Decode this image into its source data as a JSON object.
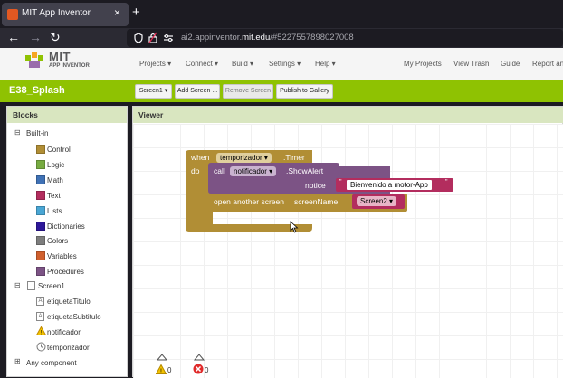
{
  "browser": {
    "tab_title": "MIT App Inventor",
    "tab_close": "×",
    "new_tab": "+",
    "url_prefix": "ai2.appinventor.",
    "url_host": "mit.edu",
    "url_rest": "/#5227557898027008"
  },
  "header": {
    "logo_title": "MIT",
    "logo_subtitle": "APP INVENTOR",
    "menus": [
      "Projects ▾",
      "Connect ▾",
      "Build ▾",
      "Settings ▾",
      "Help ▾"
    ],
    "right_links": [
      "My Projects",
      "View Trash",
      "Guide",
      "Report an"
    ]
  },
  "toolbar": {
    "project_name": "E38_Splash",
    "screen_select": "Screen1 ▾",
    "add_screen": "Add Screen ...",
    "remove_screen": "Remove Screen",
    "publish": "Publish to Gallery"
  },
  "blocks_panel": {
    "title": "Blocks",
    "builtin_label": "Built-in",
    "builtin": [
      {
        "label": "Control",
        "color": "#b18e35"
      },
      {
        "label": "Logic",
        "color": "#77ab41"
      },
      {
        "label": "Math",
        "color": "#3f71b5"
      },
      {
        "label": "Text",
        "color": "#b32d5e"
      },
      {
        "label": "Lists",
        "color": "#49a6d4"
      },
      {
        "label": "Dictionaries",
        "color": "#2d1799"
      },
      {
        "label": "Colors",
        "color": "#7d7d7d"
      },
      {
        "label": "Variables",
        "color": "#d05f2d"
      },
      {
        "label": "Procedures",
        "color": "#7c5385"
      }
    ],
    "screen_label": "Screen1",
    "components": [
      "etiquetaTitulo",
      "etiquetaSubtitulo",
      "notificador",
      "temporizador"
    ],
    "any_component": "Any component"
  },
  "viewer": {
    "title": "Viewer",
    "event_block": {
      "when": "when",
      "component": "temporizador ▾",
      "event": ".Timer",
      "do": "do",
      "color": "#b18e35"
    },
    "call_block": {
      "call": "call",
      "component": "notificador ▾",
      "method": ".ShowAlert",
      "param": "notice",
      "color": "#7c5385"
    },
    "text_block": {
      "value": "Bienvenido a motor-App",
      "color": "#b32d5e"
    },
    "open_screen_block": {
      "label": "open another screen",
      "param": "screenName",
      "color": "#b18e35"
    },
    "screen_dropdown": "Screen2 ▾",
    "warnings_count": "0",
    "errors_count": "0"
  }
}
